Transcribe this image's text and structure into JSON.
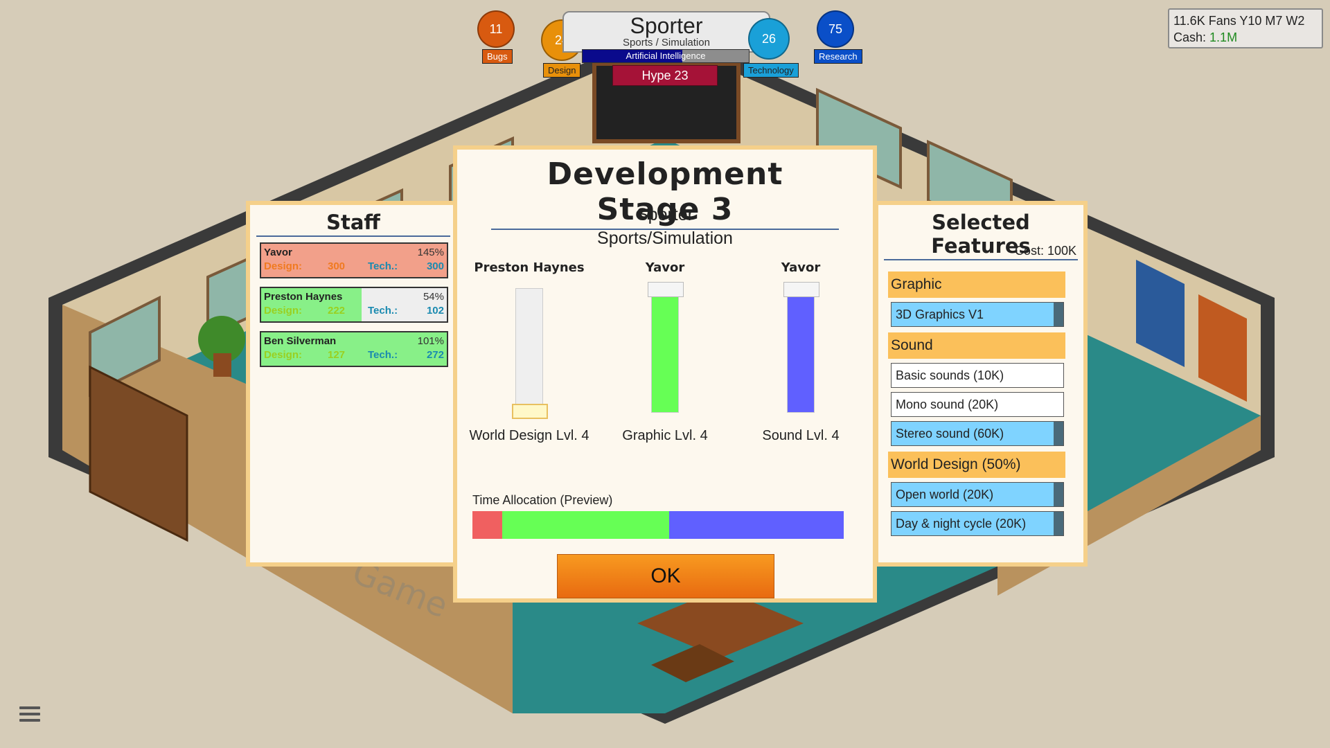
{
  "colors": {
    "bugs": "#d85a10",
    "design": "#e8900a",
    "technology": "#1aa0d8",
    "research": "#0a4fc8",
    "panel_border": "#f5d08a",
    "design_green": "#66ff55",
    "tech_blue": "#6060ff",
    "world_red": "#f06060",
    "feature_selected": "#7fd3ff",
    "category_bg": "#fbc05a"
  },
  "hud": {
    "bugs": {
      "value": "11",
      "label": "Bugs",
      "icon": "bug-circle"
    },
    "design": {
      "value": "24",
      "label": "Design",
      "icon": "design-circle"
    },
    "technology": {
      "value": "26",
      "label": "Technology",
      "icon": "technology-circle"
    },
    "research": {
      "value": "75",
      "label": "Research",
      "icon": "research-circle"
    },
    "game_title": "Sporter",
    "game_genre": "Sports / Simulation",
    "research_topic": "Artificial Intelligence",
    "research_progress": 0.6,
    "hype": "Hype 23",
    "fans_line": "11.6K Fans Y10 M7 W2",
    "cash_label": "Cash:",
    "cash_value": "1.1M",
    "menu_icon": "hamburger-menu-icon"
  },
  "staff": {
    "title": "Staff",
    "members": [
      {
        "name": "Yavor",
        "efficiency": "145%",
        "design_label": "Design:",
        "design": "300",
        "tech_label": "Tech.:",
        "tech": "300",
        "state": "red",
        "fill": 1.0
      },
      {
        "name": "Preston Haynes",
        "efficiency": "54%",
        "design_label": "Design:",
        "design": "222",
        "tech_label": "Tech.:",
        "tech": "102",
        "state": "green",
        "fill": 0.54
      },
      {
        "name": "Ben Silverman",
        "efficiency": "101%",
        "design_label": "Design:",
        "design": "127",
        "tech_label": "Tech.:",
        "tech": "272",
        "state": "green",
        "fill": 1.0
      }
    ]
  },
  "dev": {
    "title": "Development Stage 3",
    "game_name": "Sporter",
    "genre": "Sports/Simulation",
    "columns": [
      {
        "staff": "Preston Haynes",
        "label": "World Design Lvl. 4",
        "level": 0.0,
        "color": "#f5f5f5"
      },
      {
        "staff": "Yavor",
        "label": "Graphic Lvl. 4",
        "level": 1.0,
        "color": "#66ff55"
      },
      {
        "staff": "Yavor",
        "label": "Sound Lvl. 4",
        "level": 1.0,
        "color": "#6060ff"
      }
    ],
    "time_label": "Time Allocation (Preview)",
    "time_allocation": [
      {
        "name": "World Design",
        "fraction": 0.08,
        "color": "#f06060"
      },
      {
        "name": "Graphic",
        "fraction": 0.45,
        "color": "#66ff55"
      },
      {
        "name": "Sound",
        "fraction": 0.47,
        "color": "#6060ff"
      }
    ],
    "ok_label": "OK"
  },
  "features": {
    "title": "Selected Features",
    "cost": "Cost: 100K",
    "categories": [
      {
        "name": "Graphic",
        "items": [
          {
            "label": "3D Graphics V1",
            "selected": true
          }
        ]
      },
      {
        "name": "Sound",
        "items": [
          {
            "label": "Basic sounds (10K)",
            "selected": false
          },
          {
            "label": "Mono sound (20K)",
            "selected": false
          },
          {
            "label": "Stereo sound (60K)",
            "selected": true
          }
        ]
      },
      {
        "name": "World Design (50%)",
        "items": [
          {
            "label": "Open world (20K)",
            "selected": true
          },
          {
            "label": "Day & night cycle (20K)",
            "selected": true
          }
        ]
      }
    ]
  }
}
